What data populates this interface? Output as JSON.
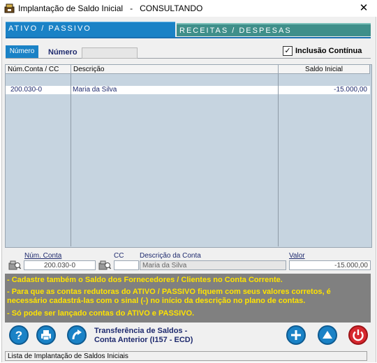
{
  "window": {
    "title": "Implantação de Saldo Inicial   -   CONSULTANDO"
  },
  "tabs": {
    "ativo_passivo": "ATIVO / PASSIVO",
    "receitas_despesas": "RECEITAS / DESPESAS"
  },
  "filter": {
    "subtab_label": "Número",
    "numero_label": "Número",
    "numero_value": "",
    "inclusao_label": "Inclusão Contínua",
    "inclusao_checked": "✓"
  },
  "grid": {
    "columns": [
      "Núm.Conta / CC",
      "Descrição",
      "Saldo Inicial"
    ],
    "rows": [
      {
        "conta": "200.030-0",
        "descricao": "Maria da Silva",
        "saldo": "-15.000,00"
      }
    ]
  },
  "form": {
    "num_conta_label": "Núm. Conta",
    "num_conta_value": "200.030-0",
    "cc_label": "CC",
    "cc_value": "",
    "descricao_label": "Descrição da Conta",
    "descricao_value": "Maria da Silva",
    "valor_label": "Valor",
    "valor_value": "-15.000,00"
  },
  "info": {
    "line1": "- Cadastre também o Saldo dos Fornecedores / Clientes no Conta Corrente.",
    "line2": "- Para que as contas redutoras do ATIVO / PASSIVO fiquem com seus valores corretos, é",
    "line3": "necessário cadastrá-las com o sinal (-) no início da descrição no plano de contas.",
    "line4": "- Só pode ser lançado contas do ATIVO e PASSIVO."
  },
  "actions": {
    "transfer_line1": "Transferência de Saldos -",
    "transfer_line2": "Conta Anterior (I157 - ECD)",
    "help_icon": "help-icon",
    "print_icon": "print-icon",
    "transfer_icon": "transfer-arrow-icon",
    "add_icon": "add-icon",
    "up_icon": "arrow-up-icon",
    "power_icon": "power-icon"
  },
  "status": {
    "text": "Lista de Implantação de Saldos Iniciais"
  },
  "colors": {
    "tab_active": "#1a82c6",
    "tab_inactive": "#3f8f8a",
    "info_bg": "#808080",
    "info_text": "#ffe300",
    "grid_bg": "#c6d4e0",
    "exit_button": "#d7282f"
  }
}
